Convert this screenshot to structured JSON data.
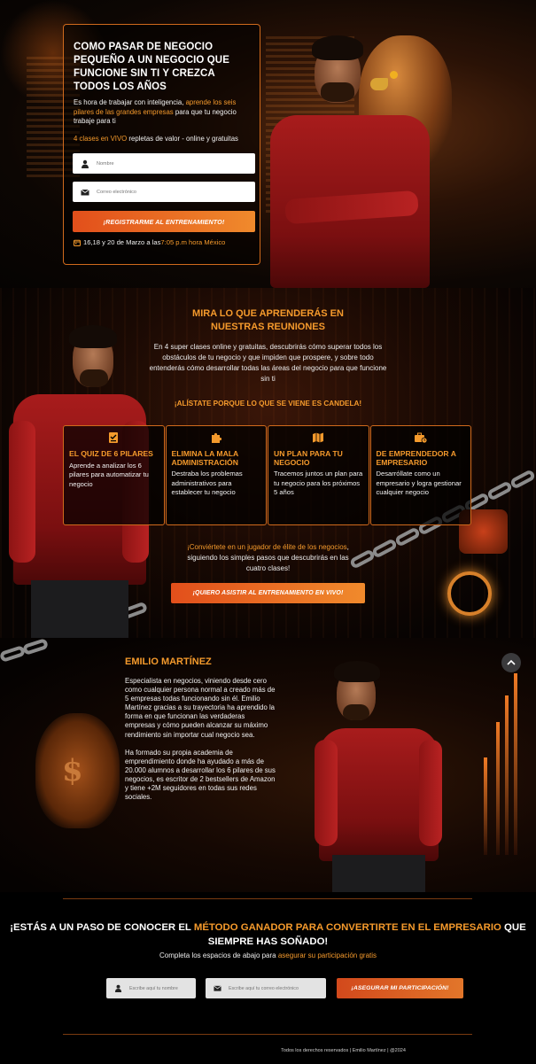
{
  "hero": {
    "title": "COMO PASAR DE NEGOCIO PEQUEÑO A UN NEGOCIO QUE FUNCIONE SIN TI Y CREZCA TODOS LOS AÑOS",
    "intro_pre": "Es hora de trabajar con inteligencia, ",
    "intro_highlight": "aprende los seis pilares de las grandes empresas",
    "intro_post": " para que tu negocio trabaje para ti",
    "classes_highlight": "4 clases en VIVO",
    "classes_post": " repletas de valor - online y gratuitas",
    "name_placeholder": "Nombre",
    "email_placeholder": "Correo electrónico",
    "register_button": "¡REGISTRARME AL ENTRENAMIENTO!",
    "date_pre": "16,18 y 20 de Marzo a las ",
    "date_highlight": "7:05 p.m hora México"
  },
  "learn": {
    "title_line1": "MIRA LO QUE APRENDERÁS EN",
    "title_line2": "NUESTRAS REUNIONES",
    "body": "En 4 super clases online y gratuitas, descubrirás cómo superar todos los obstáculos de tu negocio y que impiden que prospere, y sobre todo entenderás cómo desarrollar todas las áreas del negocio para que funcione sin ti",
    "tagline": "¡ALÍSTATE PORQUE LO QUE SE VIENE ES CANDELA!",
    "cards": [
      {
        "icon": "checklist-icon",
        "title": "EL QUIZ DE 6 PILARES",
        "text": "Aprende a analizar los 6 pilares para automatizar tu negocio"
      },
      {
        "icon": "puzzle-icon",
        "title": "ELIMINA LA MALA ADMINISTRACIÓN",
        "text": "Destraba los problemas administrativos para establecer tu negocio"
      },
      {
        "icon": "map-icon",
        "title": "UN PLAN PARA TU NEGOCIO",
        "text": "Tracemos juntos un plan para tu negocio para los próximos 5 años"
      },
      {
        "icon": "briefcase-clock-icon",
        "title": "DE EMPRENDEDOR A EMPRESARIO",
        "text": "Desarróllate como un empresario y logra gestionar cualquier negocio"
      }
    ],
    "elite_highlight": "¡Conviértete en un jugador de élite de los negocios",
    "elite_post": ", siguiendo los simples pasos que descubrirás en las cuatro clases!",
    "cta_button": "¡QUIERO ASISTIR AL ENTRENAMIENTO EN VIVO!"
  },
  "bio": {
    "name": "EMILIO MARTÍNEZ",
    "paragraph1": "Especialista en negocios, viniendo desde cero como cualquier persona normal a creado más de 5 empresas todas funcionando sin él. Emilio Martínez gracias a su trayectoria ha aprendido la forma en que funcionan las verdaderas empresas y cómo pueden alcanzar su máximo rendimiento sin importar cual negocio sea.",
    "paragraph2": "Ha formado su propia academia de emprendimiento donde ha ayudado a más de 20.000 alumnos a desarrollar los 6 pilares de sus negocios, es escritor de 2 bestsellers de Amazon y tiene +2M seguidores en todas sus redes sociales."
  },
  "final": {
    "title_pre": "¡ESTÁS A UN PASO DE CONOCER EL ",
    "title_highlight1": "MÉTODO GANADOR PARA CONVERTIRTE EN EL EMPRESARIO",
    "title_post": " QUE SIEMPRE HAS SOÑADO!",
    "sub_pre": "Completa los espacios de abajo para ",
    "sub_highlight": "asegurar su participación gratis",
    "name_placeholder": "Escribe aquí tu nombre",
    "email_placeholder": "Escribe aquí tu correo electrónico",
    "cta_button": "¡ASEGURAR MI PARTICIPACIÓN!",
    "footer": "Todos los derechos reservados | Emilio Martínez | @2024"
  },
  "colors": {
    "accent": "#f59a2c",
    "button_start": "#e24f1b",
    "button_end": "#f08a2c",
    "card_border": "#d06a1c"
  }
}
